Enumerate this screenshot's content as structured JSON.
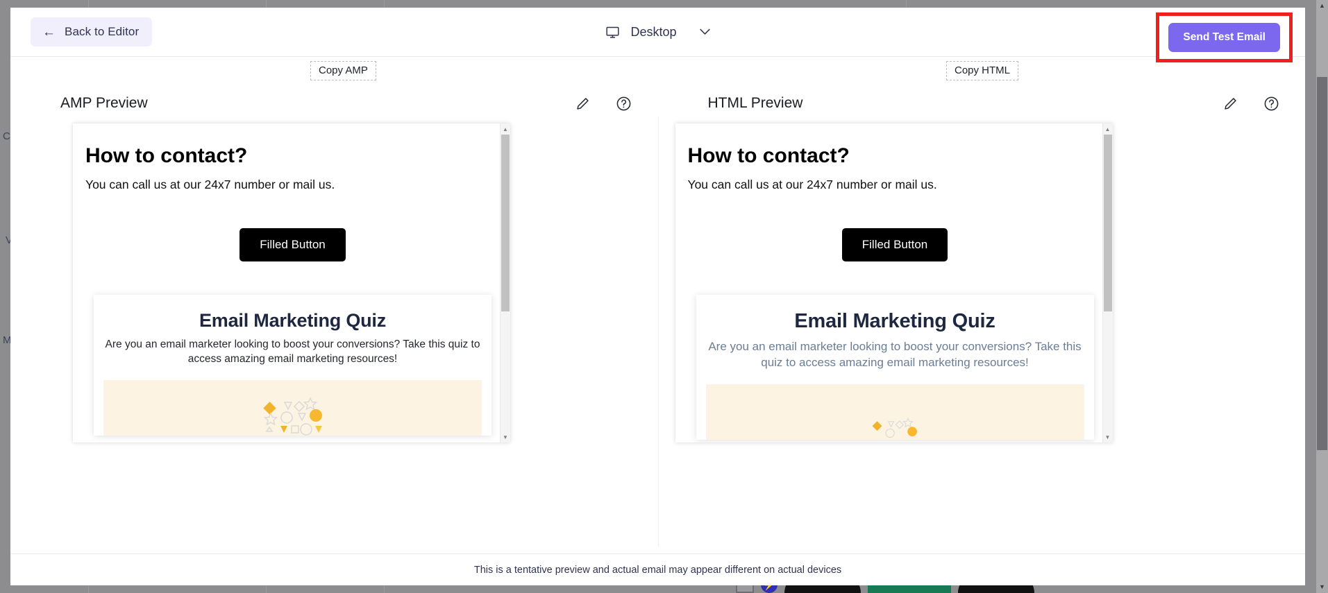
{
  "header": {
    "back_label": "Back to Editor",
    "back_icon": "arrow-left-icon",
    "device_label": "Desktop",
    "device_icon": "desktop-monitor-icon",
    "device_chevron": "chevron-down-icon",
    "send_test_email_label": "Send Test Email",
    "highlight_color": "#ee2020",
    "accent_color": "#7b68ee"
  },
  "copy_buttons": {
    "amp": "Copy AMP",
    "html": "Copy HTML"
  },
  "panels": [
    {
      "title": "AMP Preview",
      "edit_icon": "pencil-icon",
      "help_icon": "question-circle-icon",
      "email": {
        "heading": "How to contact?",
        "paragraph": "You can call us at our 24x7 number or mail us.",
        "button_label": "Filled Button",
        "quiz_title": "Email Marketing Quiz",
        "quiz_subtitle": "Are you an email marketer looking to boost your conversions? Take this quiz to access amazing email marketing resources!"
      }
    },
    {
      "title": "HTML Preview",
      "edit_icon": "pencil-icon",
      "help_icon": "question-circle-icon",
      "email": {
        "heading": "How to contact?",
        "paragraph": "You can call us at our 24x7 number or mail us.",
        "button_label": "Filled Button",
        "quiz_title": "Email Marketing Quiz",
        "quiz_subtitle": "Are you an email marketer looking to boost your conversions? Take this quiz to access amazing email marketing resources!"
      }
    }
  ],
  "footer": {
    "note": "This is a tentative preview and actual email may appear different on actual devices"
  },
  "background": {
    "partial_texts": [
      "C",
      "V",
      "M"
    ],
    "badge_icon": "lightning-bolt-icon"
  }
}
